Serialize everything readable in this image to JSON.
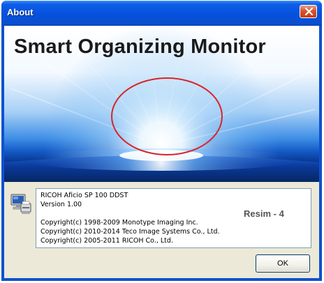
{
  "window": {
    "title": "About",
    "close_icon": "close-icon"
  },
  "banner": {
    "title": "Smart Organizing Monitor"
  },
  "info": {
    "icon": "computer-printer-icon",
    "lines": [
      "RICOH Aficio SP 100 DDST",
      "Version 1.00",
      "Copyright(c) 1998-2009 Monotype Imaging Inc.",
      "Copyright(c) 2010-2014 Teco Image Systems Co., Ltd.",
      "Copyright(c) 2005-2011 RICOH Co., Ltd."
    ],
    "annotation": "Resim - 4"
  },
  "buttons": {
    "ok_label": "OK"
  },
  "colors": {
    "titlebar": "#0a52cf",
    "highlight_ellipse": "#d9232a",
    "dialog_face": "#ece9d8"
  }
}
